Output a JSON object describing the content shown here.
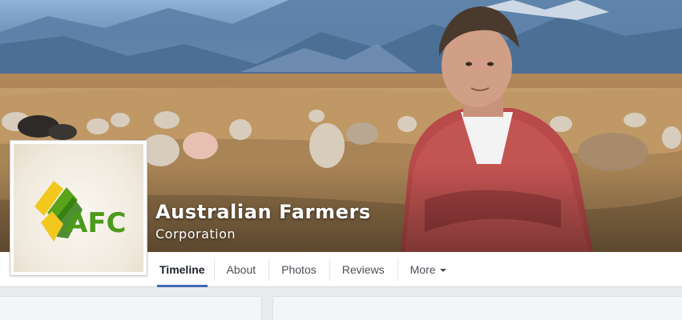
{
  "page": {
    "name": "Australian Farmers",
    "category": "Corporation"
  },
  "logo": {
    "letters": "AFC",
    "colors": {
      "yellow": "#f2c81e",
      "green": "#5aa31c",
      "dark_green": "#2f7d12"
    }
  },
  "tabs": [
    {
      "label": "Timeline",
      "active": true
    },
    {
      "label": "About",
      "active": false
    },
    {
      "label": "Photos",
      "active": false
    },
    {
      "label": "Reviews",
      "active": false
    },
    {
      "label": "More",
      "active": false,
      "icon": "caret-down-icon"
    }
  ],
  "colors": {
    "accent": "#4267b2",
    "nav_bg": "#ffffff",
    "page_bg": "#e9ebee"
  }
}
